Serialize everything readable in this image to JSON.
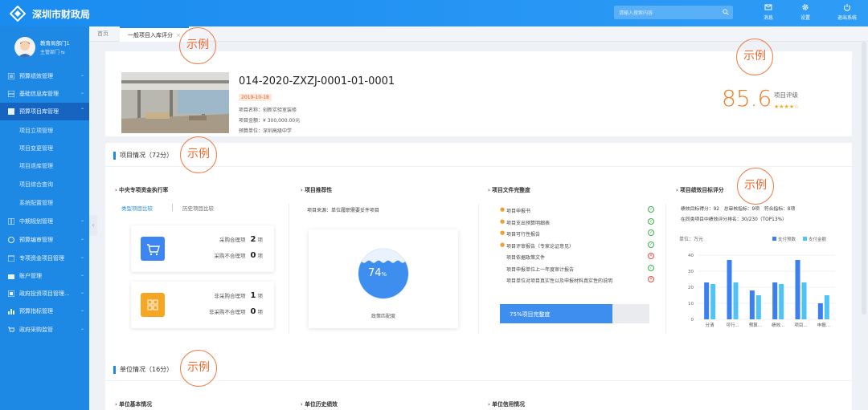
{
  "app": {
    "title": "深圳市财政局"
  },
  "search": {
    "placeholder": "请输入搜索内容"
  },
  "topbar": {
    "buttons": [
      {
        "label": "消息"
      },
      {
        "label": "设置"
      },
      {
        "label": "退出系统"
      }
    ]
  },
  "user": {
    "name": "教育局部门1",
    "role": "主管部门 ⇆"
  },
  "sidebar": {
    "items": [
      {
        "label": "预算绩效管理",
        "arrow": "⌄"
      },
      {
        "label": "基础信息库管理",
        "arrow": "⌄"
      },
      {
        "label": "预算项目库管理",
        "arrow": "⌃"
      },
      {
        "label": "中期规划管理",
        "arrow": "⌄"
      },
      {
        "label": "预算编审管理",
        "arrow": "⌄"
      },
      {
        "label": "专项资金项目管理",
        "arrow": "⌄"
      },
      {
        "label": "账户管理",
        "arrow": "⌄"
      },
      {
        "label": "政府投资项目管理...",
        "arrow": "⌄"
      },
      {
        "label": "预算指标管理",
        "arrow": "⌄"
      },
      {
        "label": "政府采购监管",
        "arrow": "⌄"
      }
    ],
    "subitems": [
      "项目立项管理",
      "项目变更管理",
      "项目退库管理",
      "项目综合查询",
      "系统配置管理"
    ],
    "collapse": "‹"
  },
  "tabs": [
    {
      "label": "首页"
    },
    {
      "label": "一般项目入库评分",
      "close": "×"
    }
  ],
  "stamp_text": "示例",
  "project": {
    "code": "014-2020-ZXZJ-0001-01-0001",
    "date": "2019-10-18",
    "name": "项目名称：创新实验室装修",
    "amount": "项目金额：¥ 300,000.00元",
    "unit": "预算单位：深圳高级中学",
    "score": "85.6",
    "score_label": "项目评级",
    "stars": "★★★★☆"
  },
  "section1": {
    "title": "项目情况（72分）",
    "col1": {
      "title": "中央专项资金执行率",
      "link_active": "类型项目比较",
      "link_other": "历史项目比较",
      "box1": {
        "l1": "采购合理项",
        "v1": "2",
        "u1": "项",
        "l2": "采购不合理项",
        "v2": "0",
        "u2": "项"
      },
      "box2": {
        "l1": "非采购合理项",
        "v1": "1",
        "u1": "项",
        "l2": "非采购不合理项",
        "v2": "0",
        "u2": "项"
      }
    },
    "col2": {
      "title": "项目推荐性",
      "source": "项目来源：单位履职需要妥件项目",
      "percent": "74",
      "percent_unit": "%",
      "caption": "政策匹配度"
    },
    "col3": {
      "title": "项目文件完整度",
      "docs": [
        {
          "text": "项目申报书",
          "star": true,
          "status": "ok"
        },
        {
          "text": "项目支出预算明细表",
          "star": true,
          "status": "ok"
        },
        {
          "text": "项目可行性报告",
          "star": true,
          "status": "ok"
        },
        {
          "text": "项目评审报告（专家论证意见）",
          "star": true,
          "status": "ok"
        },
        {
          "text": "项目依据政策文件",
          "star": false,
          "status": "no"
        },
        {
          "text": "项目申报单位上一年度审计报告",
          "star": false,
          "status": "ok"
        },
        {
          "text": "项目单位对项目真实性以及申报材料真实性的说明",
          "star": false,
          "status": "no"
        }
      ],
      "progress_label": "75%项目完整度",
      "progress_value": 0.75
    },
    "col4": {
      "title": "项目绩效目标评分",
      "line1": "绩效目标得分：92　总审核指标：9项　符合指标：8项",
      "line2": "在同类项目中绩效评分排名：30/230（TOP13%）"
    }
  },
  "chart_data": {
    "type": "bar",
    "unit_label": "单位：万元",
    "categories": [
      "分清",
      "可行...",
      "预算...",
      "绩效...",
      "项目...",
      "申报..."
    ],
    "series": [
      {
        "name": "支付预数",
        "color": "#3b7ff0",
        "values": [
          23,
          37,
          18,
          23,
          37,
          10
        ]
      },
      {
        "name": "支付金额",
        "color": "#4fc3f7",
        "values": [
          22,
          23,
          15,
          22,
          23,
          15
        ]
      }
    ],
    "yticks": [
      0,
      10,
      20,
      30,
      40
    ],
    "ylim": [
      0,
      40
    ],
    "legend": "top-right"
  },
  "section2": {
    "title": "单位情况（16分）",
    "cols": [
      "单位基本情况",
      "单位历史绩效",
      "单位信用情况"
    ]
  }
}
